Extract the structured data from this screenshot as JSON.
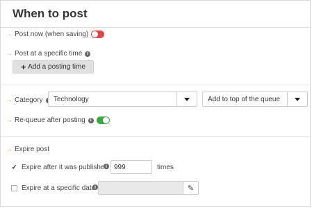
{
  "panel": {
    "title": "When to post"
  },
  "post_now": {
    "arrow": "→",
    "label": "Post now (when saving)",
    "enabled": false
  },
  "specific_time": {
    "arrow": "→",
    "label": "Post at a specific time",
    "info": "i",
    "add_button": {
      "plus": "+",
      "label": "Add a posting time"
    }
  },
  "category": {
    "arrow": "→",
    "label": "Category",
    "info": "i",
    "selected": "Technology",
    "queue_option": "Add to top of the queue"
  },
  "requeue": {
    "arrow": "→",
    "label": "Re-queue after posting",
    "info": "i",
    "enabled": true
  },
  "expire": {
    "arrow": "→",
    "label": "Expire post",
    "after_published": {
      "checked": true,
      "check_mark": "✓",
      "label": "Expire after it was published",
      "info": "i",
      "value": "999",
      "suffix": "times"
    },
    "specific_date": {
      "checked": false,
      "label": "Expire at a specific date",
      "info": "i",
      "value": "",
      "edit_icon": "✎"
    }
  },
  "colors": {
    "accent_orange": "#f0a030",
    "toggle_on": "#3ca844",
    "toggle_off": "#e04848"
  }
}
